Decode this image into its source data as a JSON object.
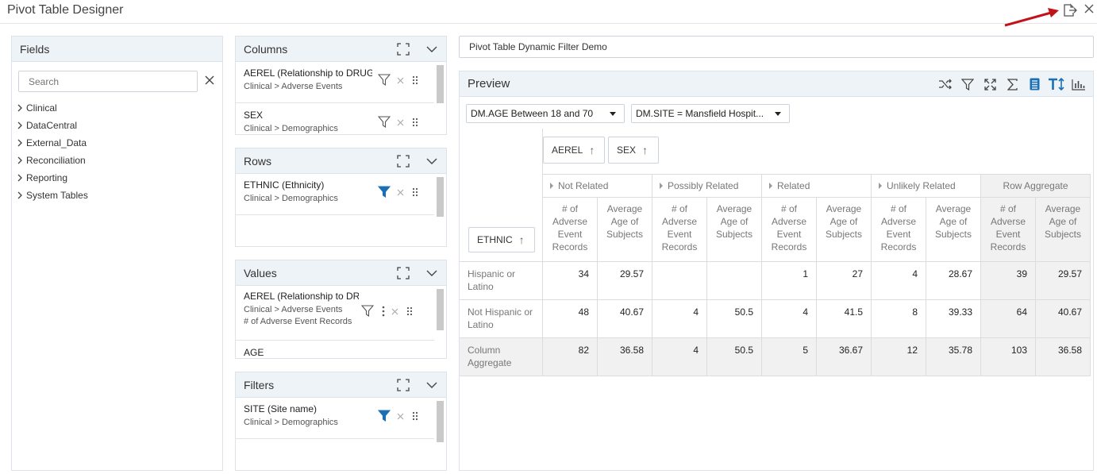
{
  "app": {
    "title": "Pivot Table Designer"
  },
  "fields_panel": {
    "title": "Fields",
    "search_placeholder": "Search",
    "tree": [
      "Clinical",
      "DataCentral",
      "External_Data",
      "Reconciliation",
      "Reporting",
      "System Tables"
    ]
  },
  "columns_panel": {
    "title": "Columns",
    "fields": [
      {
        "name": "AEREL (Relationship to DRUG_",
        "path": "Clinical > Adverse Events"
      },
      {
        "name": "SEX",
        "path": "Clinical > Demographics"
      }
    ]
  },
  "rows_panel": {
    "title": "Rows",
    "fields": [
      {
        "name": "ETHNIC (Ethnicity)",
        "path": "Clinical > Demographics"
      }
    ]
  },
  "values_panel": {
    "title": "Values",
    "fields": [
      {
        "name": "AEREL (Relationship to DR",
        "path": "Clinical > Adverse Events",
        "aggregate": "# of Adverse Event Records"
      },
      {
        "name": "AGE",
        "path": ""
      }
    ]
  },
  "filters_panel": {
    "title": "Filters",
    "fields": [
      {
        "name": "SITE (Site name)",
        "path": "Clinical > Demographics"
      }
    ]
  },
  "pivot_title": "Pivot Table Dynamic Filter Demo",
  "preview": {
    "title": "Preview",
    "filters": [
      "DM.AGE Between 18 and 70",
      "DM.SITE = Mansfield Hospit..."
    ],
    "col_chips": [
      "AEREL",
      "SEX"
    ],
    "row_chip": "ETHNIC",
    "col_groups": [
      "Not Related",
      "Possibly Related",
      "Related",
      "Unlikely Related",
      "Row Aggregate"
    ],
    "measure_a": [
      "# of",
      "Adverse",
      "Event",
      "Records"
    ],
    "measure_b": [
      "Average",
      "Age of",
      "Subjects"
    ],
    "rows": [
      {
        "label": [
          "Hispanic or",
          "Latino"
        ],
        "values": [
          "34",
          "29.57",
          "",
          "",
          "1",
          "27",
          "4",
          "28.67",
          "39",
          "29.57"
        ]
      },
      {
        "label": [
          "Not Hispanic or",
          "Latino"
        ],
        "values": [
          "48",
          "40.67",
          "4",
          "50.5",
          "4",
          "41.5",
          "8",
          "39.33",
          "64",
          "40.67"
        ]
      },
      {
        "label": [
          "Column",
          "Aggregate"
        ],
        "values": [
          "82",
          "36.58",
          "4",
          "50.5",
          "5",
          "36.67",
          "12",
          "35.78",
          "103",
          "36.58"
        ]
      }
    ]
  },
  "colors": {
    "accent": "#1a6fb5",
    "header_bg": "#eef3f8",
    "arrow": "#c0141a"
  }
}
